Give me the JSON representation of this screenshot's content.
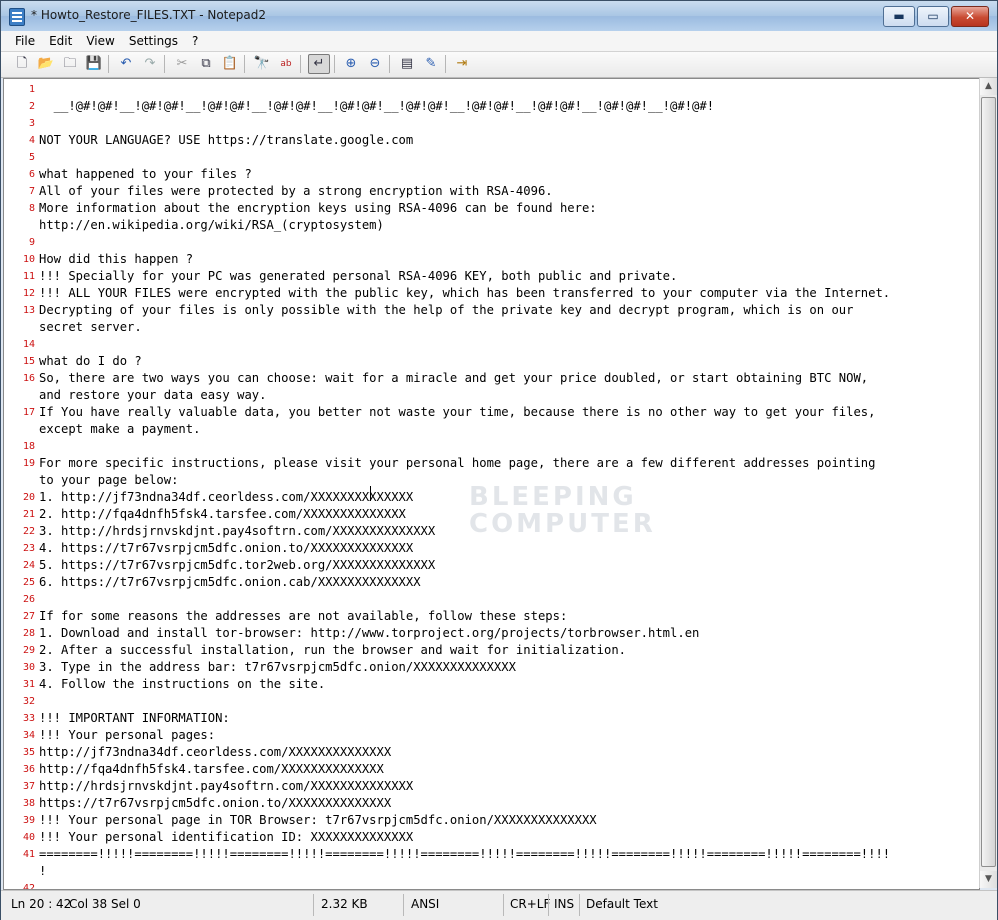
{
  "window": {
    "title": "* Howto_Restore_FILES.TXT - Notepad2",
    "minimize": "▬",
    "maximize": "▭",
    "close": "✕"
  },
  "menu": [
    "File",
    "Edit",
    "View",
    "Settings",
    "?"
  ],
  "toolbar_icons": [
    "new-file-icon",
    "open-folder-icon",
    "browse-icon",
    "save-icon",
    "undo-icon",
    "redo-icon",
    "cut-icon",
    "copy-icon",
    "paste-icon",
    "find-icon",
    "replace-icon",
    "word-wrap-icon",
    "zoom-in-icon",
    "zoom-out-icon",
    "scheme-icon",
    "customize-icon",
    "exit-icon"
  ],
  "editor": {
    "line_numbers": [
      "1",
      "2",
      "3",
      "4",
      "5",
      "6",
      "7",
      "8",
      "",
      "9",
      "10",
      "11",
      "12",
      "13",
      "",
      "14",
      "15",
      "16",
      "",
      "17",
      "",
      "18",
      "19",
      "",
      "20",
      "21",
      "22",
      "23",
      "24",
      "25",
      "26",
      "27",
      "28",
      "29",
      "30",
      "31",
      "32",
      "33",
      "34",
      "35",
      "36",
      "37",
      "38",
      "39",
      "40",
      "41",
      "",
      "42"
    ],
    "lines": [
      "",
      "  __!@#!@#!__!@#!@#!__!@#!@#!__!@#!@#!__!@#!@#!__!@#!@#!__!@#!@#!__!@#!@#!__!@#!@#!__!@#!@#!",
      "",
      "NOT YOUR LANGUAGE? USE https://translate.google.com",
      "",
      "what happened to your files ?",
      "All of your files were protected by a strong encryption with RSA-4096.",
      "More information about the encryption keys using RSA-4096 can be found here:",
      "http://en.wikipedia.org/wiki/RSA_(cryptosystem)",
      "",
      "How did this happen ?",
      "!!! Specially for your PC was generated personal RSA-4096 KEY, both public and private.",
      "!!! ALL YOUR FILES were encrypted with the public key, which has been transferred to your computer via the Internet.",
      "Decrypting of your files is only possible with the help of the private key and decrypt program, which is on our",
      "secret server.",
      "",
      "what do I do ?",
      "So, there are two ways you can choose: wait for a miracle and get your price doubled, or start obtaining BTC NOW,",
      "and restore your data easy way.",
      "If You have really valuable data, you better not waste your time, because there is no other way to get your files,",
      "except make a payment.",
      "",
      "For more specific instructions, please visit your personal home page, there are a few different addresses pointing",
      "to your page below:",
      "1. http://jf73ndna34df.ceorldess.com/XXXXXXXXXXXXXX",
      "2. http://fqa4dnfh5fsk4.tarsfee.com/XXXXXXXXXXXXXX",
      "3. http://hrdsjrnvskdjnt.pay4softrn.com/XXXXXXXXXXXXXX",
      "4. https://t7r67vsrpjcm5dfc.onion.to/XXXXXXXXXXXXXX",
      "5. https://t7r67vsrpjcm5dfc.tor2web.org/XXXXXXXXXXXXXX",
      "6. https://t7r67vsrpjcm5dfc.onion.cab/XXXXXXXXXXXXXX",
      "",
      "If for some reasons the addresses are not available, follow these steps:",
      "1. Download and install tor-browser: http://www.torproject.org/projects/torbrowser.html.en",
      "2. After a successful installation, run the browser and wait for initialization.",
      "3. Type in the address bar: t7r67vsrpjcm5dfc.onion/XXXXXXXXXXXXXX",
      "4. Follow the instructions on the site.",
      "",
      "!!! IMPORTANT INFORMATION:",
      "!!! Your personal pages:",
      "http://jf73ndna34df.ceorldess.com/XXXXXXXXXXXXXX",
      "http://fqa4dnfh5fsk4.tarsfee.com/XXXXXXXXXXXXXX",
      "http://hrdsjrnvskdjnt.pay4softrn.com/XXXXXXXXXXXXXX",
      "https://t7r67vsrpjcm5dfc.onion.to/XXXXXXXXXXXXXX",
      "!!! Your personal page in TOR Browser: t7r67vsrpjcm5dfc.onion/XXXXXXXXXXXXXX",
      "!!! Your personal identification ID: XXXXXXXXXXXXXX",
      "========!!!!!========!!!!!========!!!!!========!!!!!========!!!!!========!!!!!========!!!!!========!!!!!========!!!!",
      "!",
      ""
    ],
    "watermark": [
      "BLEEPING",
      "COMPUTER"
    ]
  },
  "status": {
    "position": "Ln 20 : 42",
    "col": "Col 38",
    "sel": "Sel 0",
    "size": "2.32 KB",
    "encoding": "ANSI",
    "eol": "CR+LF",
    "ins": "INS",
    "scheme": "Default Text"
  }
}
